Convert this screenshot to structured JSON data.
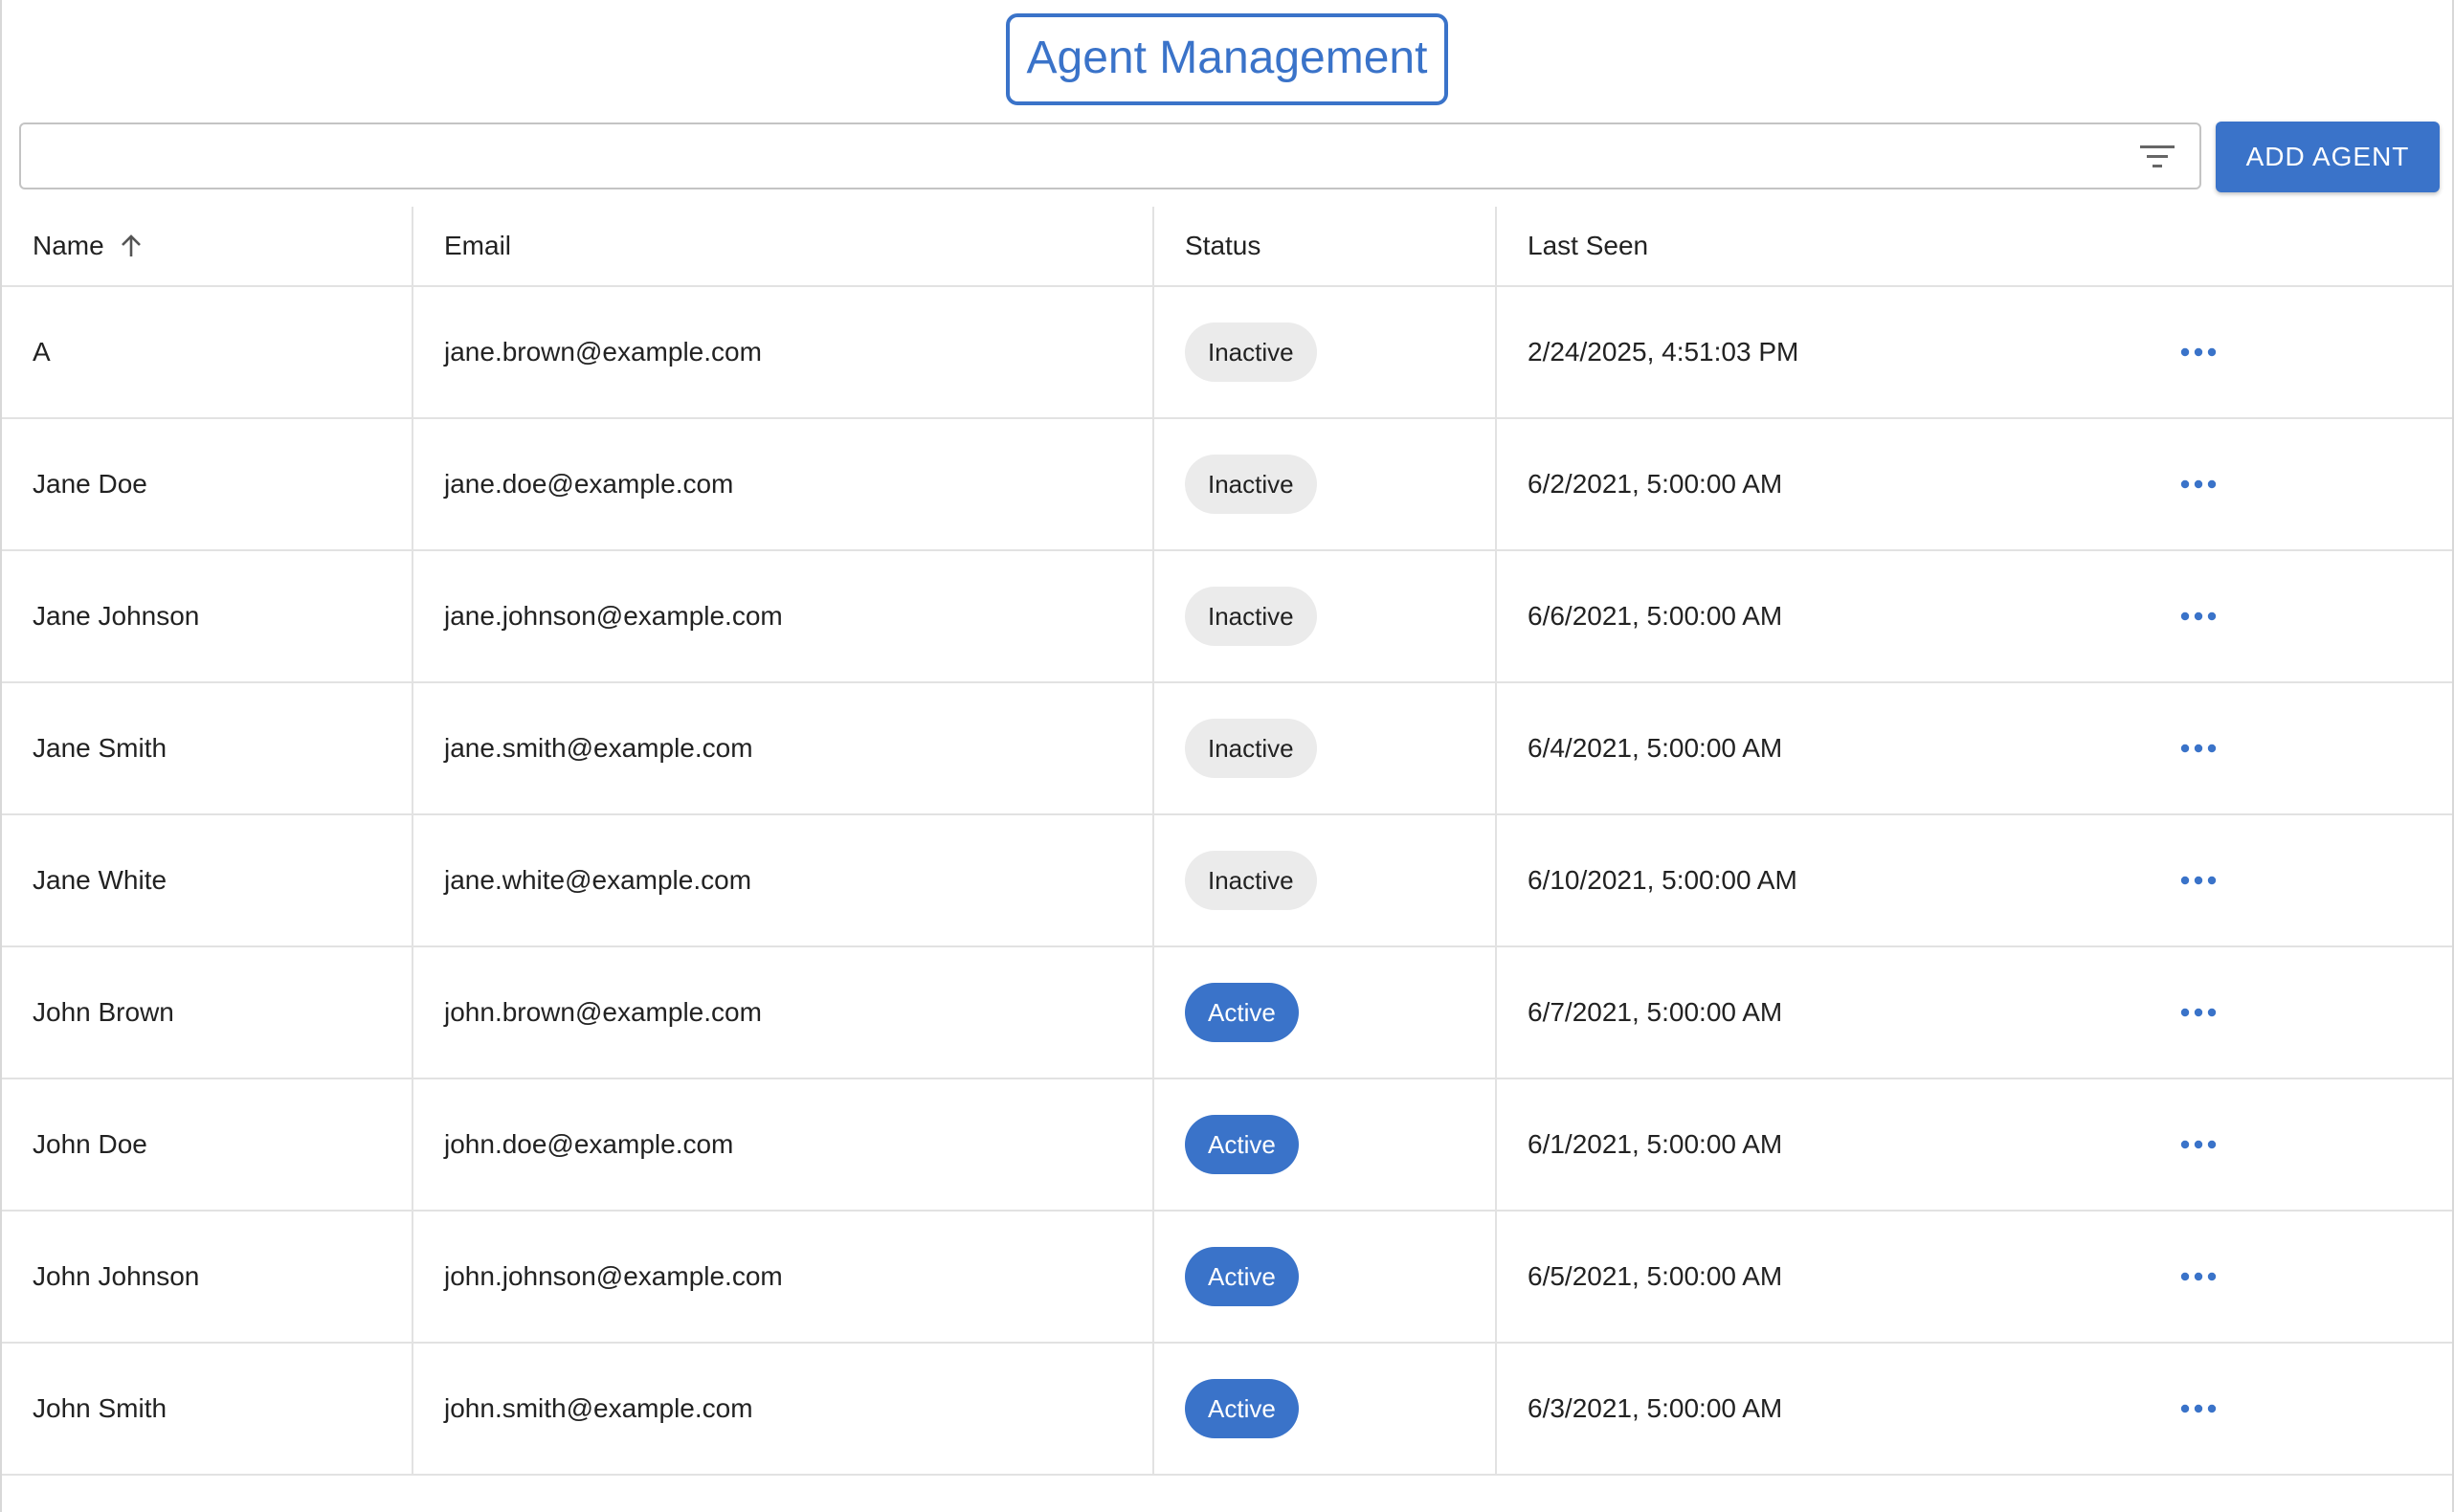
{
  "page": {
    "title": "Agent Management"
  },
  "toolbar": {
    "search_value": "",
    "add_label": "ADD AGENT"
  },
  "colors": {
    "accent": "#3a73c9",
    "inactive_chip": "#ebebeb"
  },
  "icons": {
    "filter": "filter-list-icon",
    "sort": "arrow-up-icon",
    "row_menu": "more-horizontal-icon"
  },
  "table": {
    "columns": {
      "name": "Name",
      "email": "Email",
      "status": "Status",
      "last_seen": "Last Seen"
    },
    "rows": [
      {
        "name": "A",
        "email": "jane.brown@example.com",
        "status": "Inactive",
        "last_seen": "2/24/2025, 4:51:03 PM"
      },
      {
        "name": "Jane Doe",
        "email": "jane.doe@example.com",
        "status": "Inactive",
        "last_seen": "6/2/2021, 5:00:00 AM"
      },
      {
        "name": "Jane Johnson",
        "email": "jane.johnson@example.com",
        "status": "Inactive",
        "last_seen": "6/6/2021, 5:00:00 AM"
      },
      {
        "name": "Jane Smith",
        "email": "jane.smith@example.com",
        "status": "Inactive",
        "last_seen": "6/4/2021, 5:00:00 AM"
      },
      {
        "name": "Jane White",
        "email": "jane.white@example.com",
        "status": "Inactive",
        "last_seen": "6/10/2021, 5:00:00 AM"
      },
      {
        "name": "John Brown",
        "email": "john.brown@example.com",
        "status": "Active",
        "last_seen": "6/7/2021, 5:00:00 AM"
      },
      {
        "name": "John Doe",
        "email": "john.doe@example.com",
        "status": "Active",
        "last_seen": "6/1/2021, 5:00:00 AM"
      },
      {
        "name": "John Johnson",
        "email": "john.johnson@example.com",
        "status": "Active",
        "last_seen": "6/5/2021, 5:00:00 AM"
      },
      {
        "name": "John Smith",
        "email": "john.smith@example.com",
        "status": "Active",
        "last_seen": "6/3/2021, 5:00:00 AM"
      }
    ]
  }
}
